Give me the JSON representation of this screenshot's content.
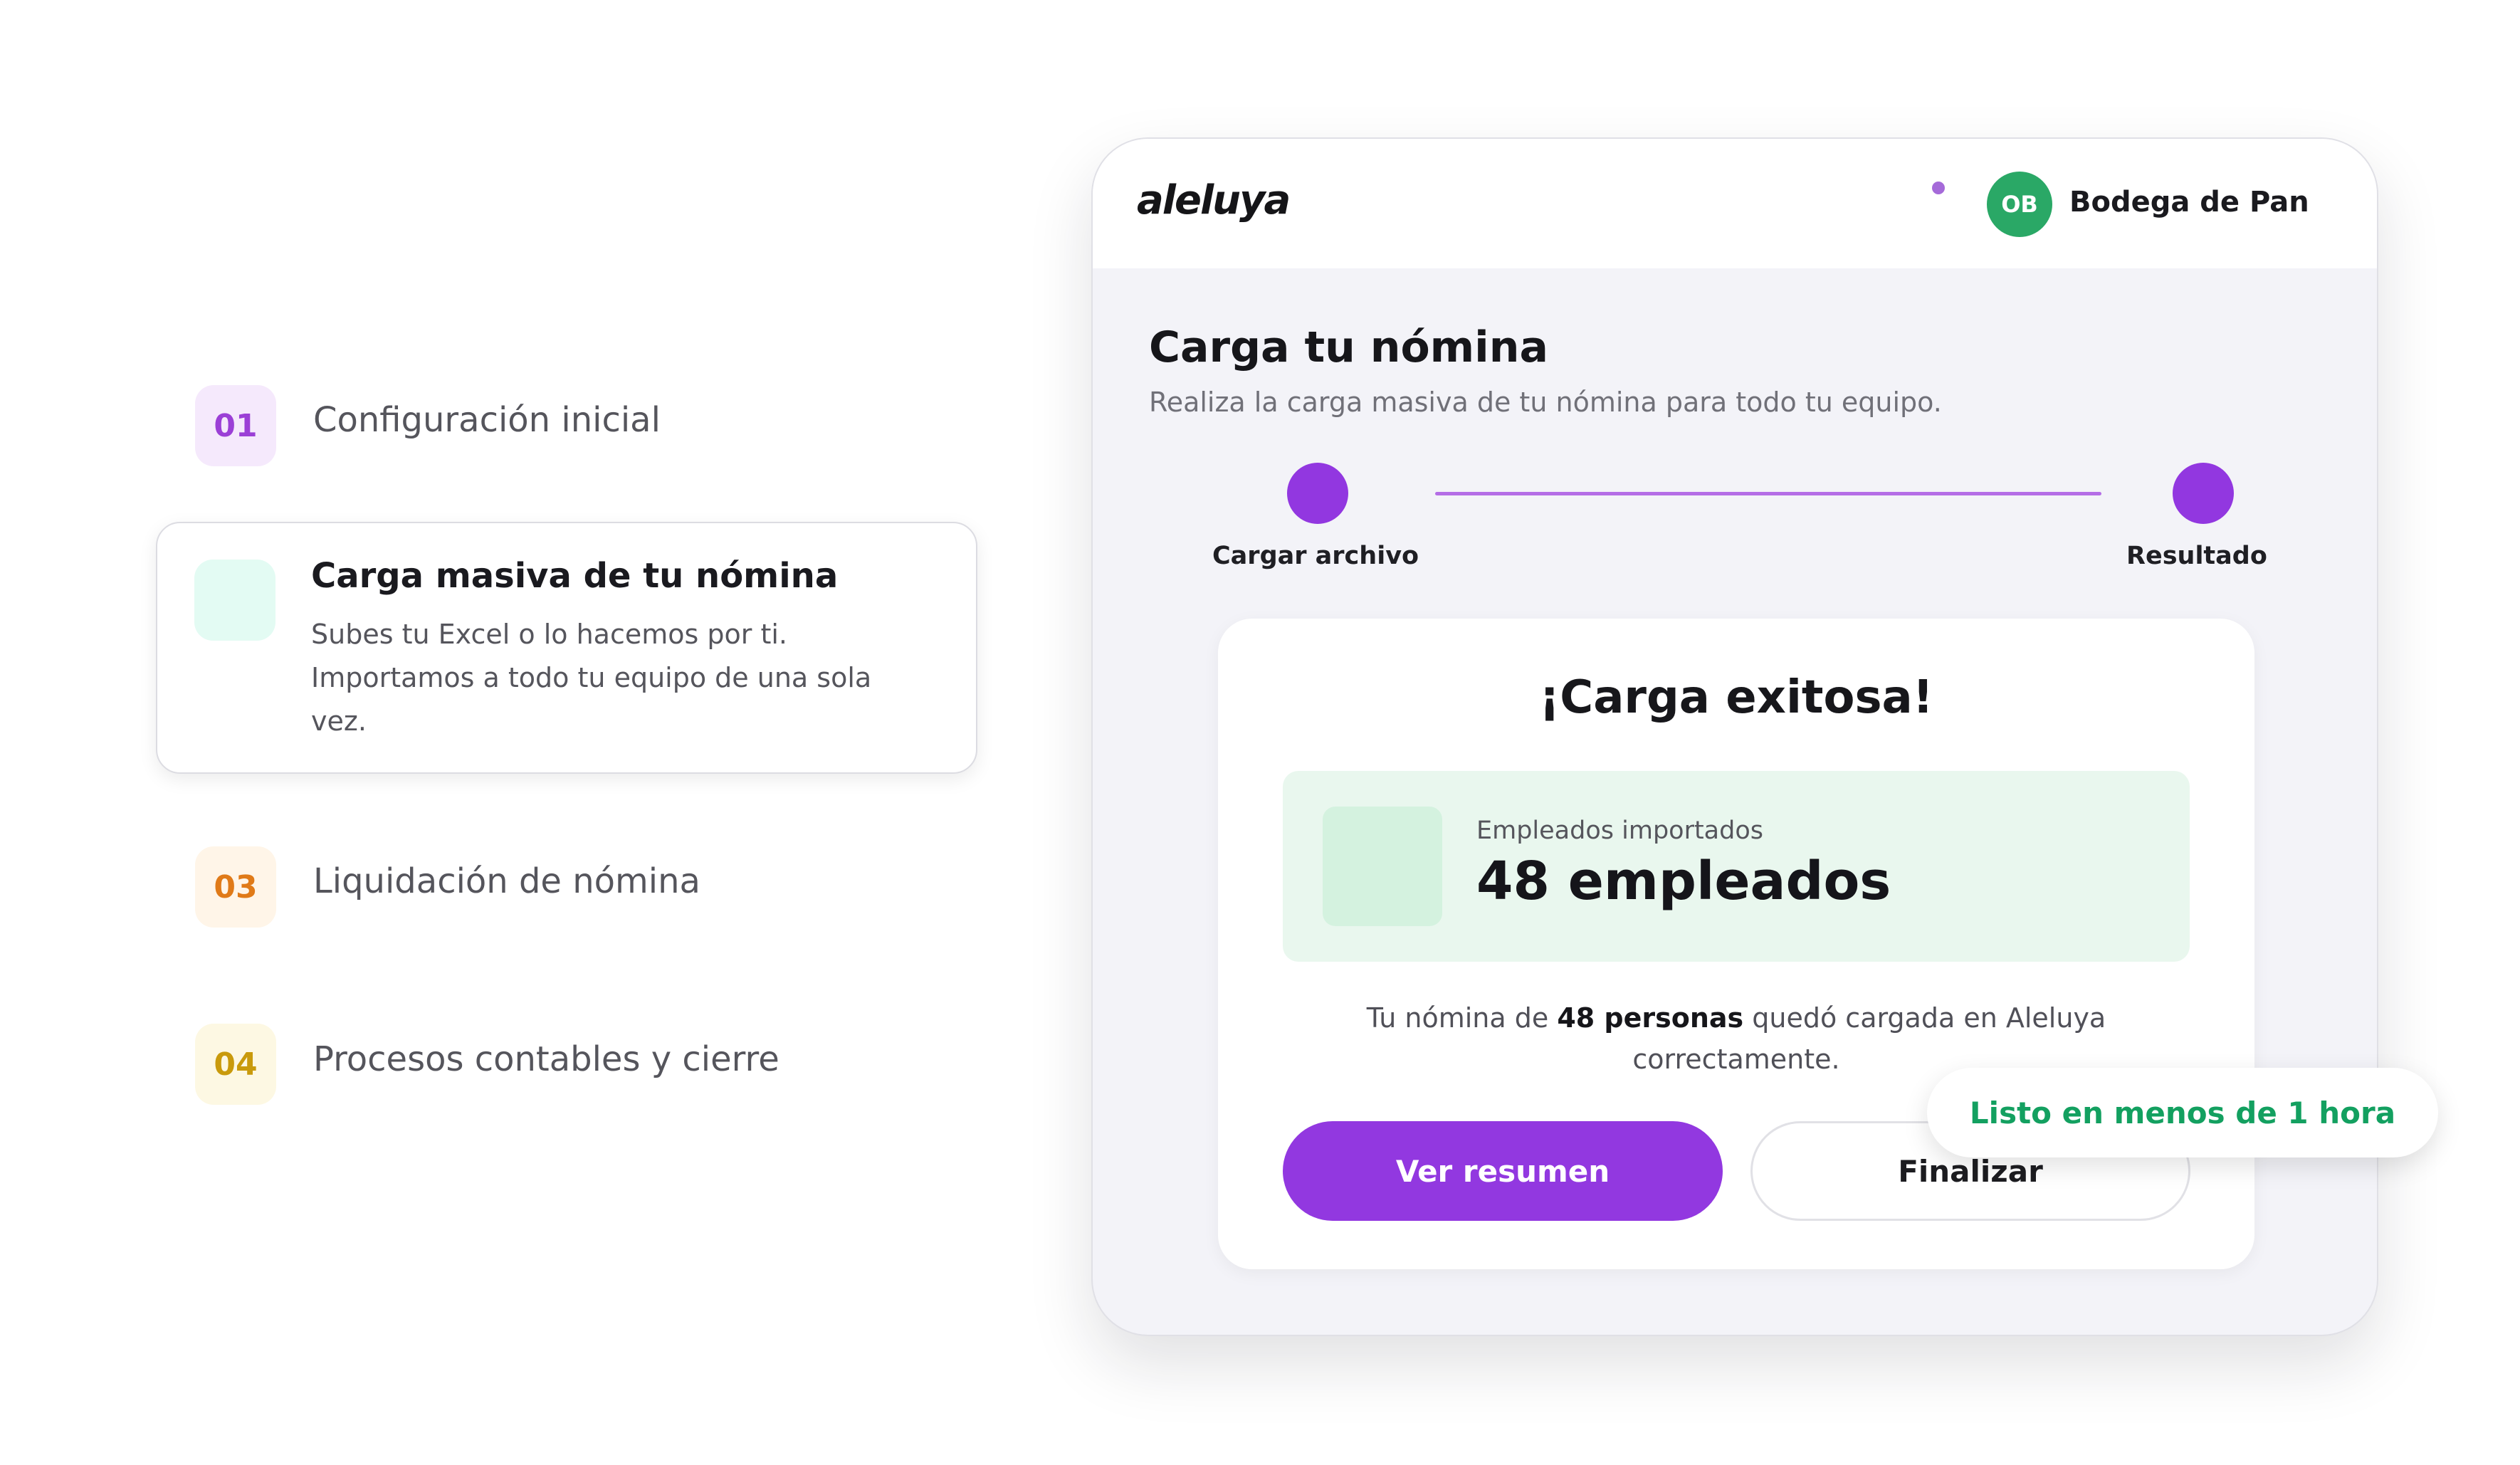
{
  "steps": [
    {
      "num": "01",
      "label": "Configuración inicial",
      "color": "#9b3fd6",
      "bg": "#f5e9fc"
    },
    {
      "title": "Carga masiva de tu nómina",
      "desc": "Subes tu Excel o lo hacemos por ti. Importamos a todo tu equipo de una sola vez."
    },
    {
      "num": "03",
      "label": "Liquidación de nómina",
      "color": "#e07a18",
      "bg": "#fff5e8"
    },
    {
      "num": "04",
      "label": "Procesos contables y cierre",
      "color": "#c99a0c",
      "bg": "#fdf8e3"
    }
  ],
  "app": {
    "logo": "aleluya",
    "avatar_initials": "OB",
    "company": "Bodega de Pan",
    "page_title": "Carga tu nómina",
    "page_subtitle": "Realiza la carga masiva de tu nómina para todo tu equipo.",
    "stepper": [
      "Cargar archivo",
      "Resultado"
    ],
    "result": {
      "title": "¡Carga exitosa!",
      "stat_label": "Empleados importados",
      "stat_value": "48 empleados",
      "summary_pre": "Tu nómina de ",
      "summary_bold": "48 personas",
      "summary_post": " quedó cargada en Aleluya correctamente.",
      "primary_button": "Ver resumen",
      "secondary_button": "Finalizar"
    }
  },
  "badge": "Listo en menos de 1 hora",
  "colors": {
    "accent": "#9238e0",
    "success": "#13a060",
    "avatar": "#2aa866"
  }
}
